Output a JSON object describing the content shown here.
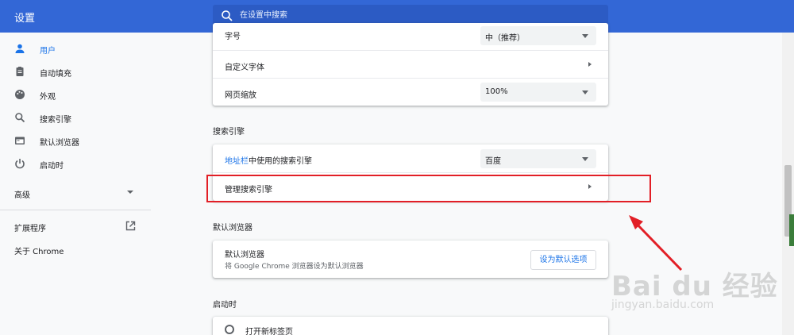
{
  "header": {
    "title": "设置",
    "search_placeholder": "在设置中搜索"
  },
  "sidebar": {
    "items": [
      {
        "label": "用户",
        "icon": "person-icon"
      },
      {
        "label": "自动填充",
        "icon": "clipboard-icon"
      },
      {
        "label": "外观",
        "icon": "palette-icon"
      },
      {
        "label": "搜索引擎",
        "icon": "search-icon"
      },
      {
        "label": "默认浏览器",
        "icon": "browser-icon"
      },
      {
        "label": "启动时",
        "icon": "power-icon"
      }
    ],
    "advanced": "高级",
    "extensions": "扩展程序",
    "about": "关于 Chrome"
  },
  "appearance_card": {
    "font_size_label": "字号",
    "font_size_value": "中（推荐）",
    "custom_fonts_label": "自定义字体",
    "page_zoom_label": "网页缩放",
    "page_zoom_value": "100%"
  },
  "search_engine": {
    "section_title": "搜索引擎",
    "address_bar_link": "地址栏",
    "address_bar_rest": "中使用的搜索引擎",
    "engine_value": "百度",
    "manage_label": "管理搜索引擎"
  },
  "default_browser": {
    "section_title": "默认浏览器",
    "title": "默认浏览器",
    "subtitle": "将 Google Chrome 浏览器设为默认浏览器",
    "button": "设为默认选项"
  },
  "startup": {
    "section_title": "启动时",
    "option1": "打开新标签页"
  },
  "watermark": {
    "brand": "Bai du 经验",
    "url": "jingyan.baidu.com"
  },
  "colors": {
    "header": "#3367d6",
    "accent": "#1a73e8",
    "highlight": "#e21f26"
  }
}
